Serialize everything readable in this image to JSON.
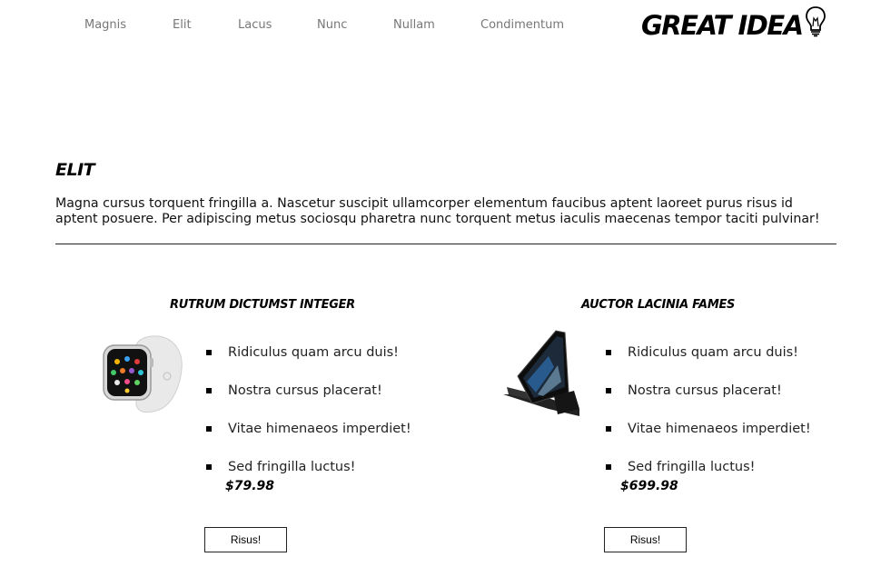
{
  "nav": {
    "items": [
      "Magnis",
      "Elit",
      "Lacus",
      "Nunc",
      "Nullam",
      "Condimentum"
    ],
    "logo_text": "GREAT IDEA",
    "logo_icon": "lightbulb-icon"
  },
  "intro": {
    "title": "Elit",
    "text": "Magna cursus torquent fringilla a. Nascetur suscipit ullamcorper elementum faucibus aptent laoreet purus risus id aptent posuere. Per adipiscing metus sociosqu pharetra nunc torquent metus iaculis maecenas tempor taciti pulvinar!"
  },
  "products": [
    {
      "title": "Rutrum dictumst integer",
      "image_icon": "smartwatch-image",
      "features": [
        "Ridiculus quam arcu duis!",
        "Nostra cursus placerat!",
        "Vitae himenaeos imperdiet!",
        "Sed fringilla luctus!"
      ],
      "price": "$79.98",
      "button_label": "Risus!"
    },
    {
      "title": "Auctor lacinia fames",
      "image_icon": "tablet-stand-image",
      "features": [
        "Ridiculus quam arcu duis!",
        "Nostra cursus placerat!",
        "Vitae himenaeos imperdiet!",
        "Sed fringilla luctus!"
      ],
      "price": "$699.98",
      "button_label": "Risus!"
    }
  ]
}
